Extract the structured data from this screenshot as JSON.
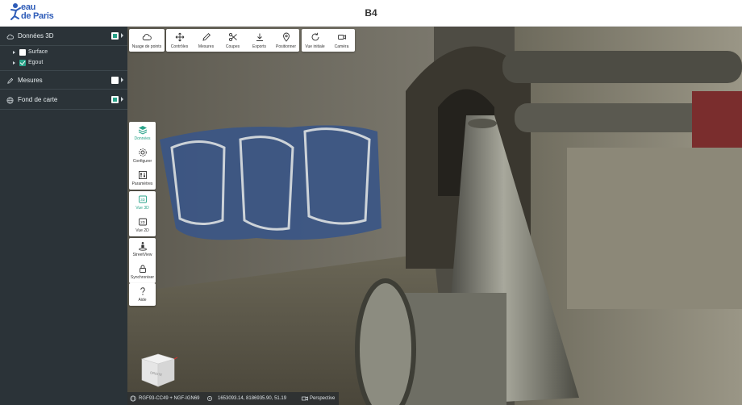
{
  "header": {
    "title": "B4",
    "logo_line1": "eau",
    "logo_line2": "de Paris"
  },
  "sidebar": {
    "sections": [
      {
        "label": "Données 3D",
        "checked": true,
        "children": [
          {
            "label": "Surface",
            "checked": false
          },
          {
            "label": "Egout",
            "checked": true
          }
        ]
      },
      {
        "label": "Mesures",
        "checked": false
      },
      {
        "label": "Fond de carte",
        "checked": true
      }
    ]
  },
  "toolbar": {
    "items": [
      {
        "label": "Nuage de points",
        "icon": "cloud-icon"
      },
      {
        "label": "Contrôles",
        "icon": "move-icon"
      },
      {
        "label": "Mesures",
        "icon": "pencil-icon"
      },
      {
        "label": "Coupes",
        "icon": "scissors-icon"
      },
      {
        "label": "Exports",
        "icon": "download-icon"
      },
      {
        "label": "Positionner",
        "icon": "pin-icon"
      },
      {
        "label": "Vue initiale",
        "icon": "reset-icon"
      },
      {
        "label": "Caméra",
        "icon": "camera-icon"
      }
    ]
  },
  "side_tools": {
    "group1": [
      {
        "label": "Données",
        "icon": "layers-icon",
        "active": true
      },
      {
        "label": "Configurer",
        "icon": "gear-icon"
      },
      {
        "label": "Paramètres",
        "icon": "sliders-icon"
      }
    ],
    "group2": [
      {
        "label": "Vue 3D",
        "icon": "view-3d-icon",
        "active": true
      },
      {
        "label": "Vue 2D",
        "icon": "view-2d-icon"
      }
    ],
    "group3": [
      {
        "label": "StreetView",
        "icon": "pedestrian-icon"
      },
      {
        "label": "Synchroniser",
        "icon": "lock-icon"
      }
    ],
    "group4": [
      {
        "label": "Aide",
        "icon": "question-icon"
      }
    ]
  },
  "status": {
    "crs": "RGF93-CC49 + NGF-IGN69",
    "coords": "1653093.14, 8186935.90, 51.19",
    "projection": "Perspective"
  },
  "nav_cube": {
    "face_label": "DROITE"
  },
  "colors": {
    "accent": "#29a389",
    "sidebar_bg": "#2b3338",
    "brand": "#2e5cb8"
  }
}
